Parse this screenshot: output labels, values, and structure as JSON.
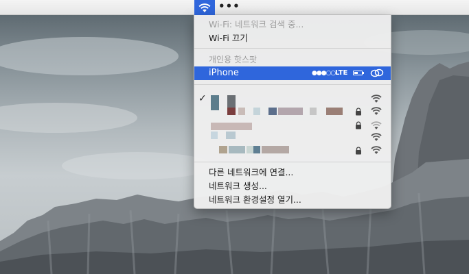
{
  "menubar": {
    "wifi_icon": "wifi-icon",
    "more_label": "•••"
  },
  "wifi_menu": {
    "status_label": "Wi-Fi: 네트워크 검색 중...",
    "turn_off_label": "Wi-Fi 끄기",
    "hotspot_header": "개인용 핫스팟",
    "hotspot": {
      "name": "iPhone",
      "signal": "●●●○○",
      "network_type": "LTE",
      "battery_icon": "battery-icon",
      "link_icon": "link-icon"
    },
    "networks": [
      {
        "name": "",
        "connected": true,
        "locked": false,
        "signal_icon": "wifi-icon"
      },
      {
        "name": "",
        "connected": false,
        "locked": true,
        "signal_icon": "wifi-icon"
      },
      {
        "name": "",
        "connected": false,
        "locked": true,
        "signal_icon": "wifi-icon"
      },
      {
        "name": "",
        "connected": false,
        "locked": false,
        "signal_icon": "wifi-icon"
      },
      {
        "name": "",
        "connected": false,
        "locked": true,
        "signal_icon": "wifi-icon"
      }
    ],
    "actions": {
      "join_other": "다른 네트워크에 연결...",
      "create_network": "네트워크 생성...",
      "open_preferences": "네트워크 환경설정 열기..."
    }
  },
  "colors": {
    "accent": "#2f66dc",
    "menu_bg": "#eeeeee",
    "disabled_text": "#9d9d9d"
  }
}
